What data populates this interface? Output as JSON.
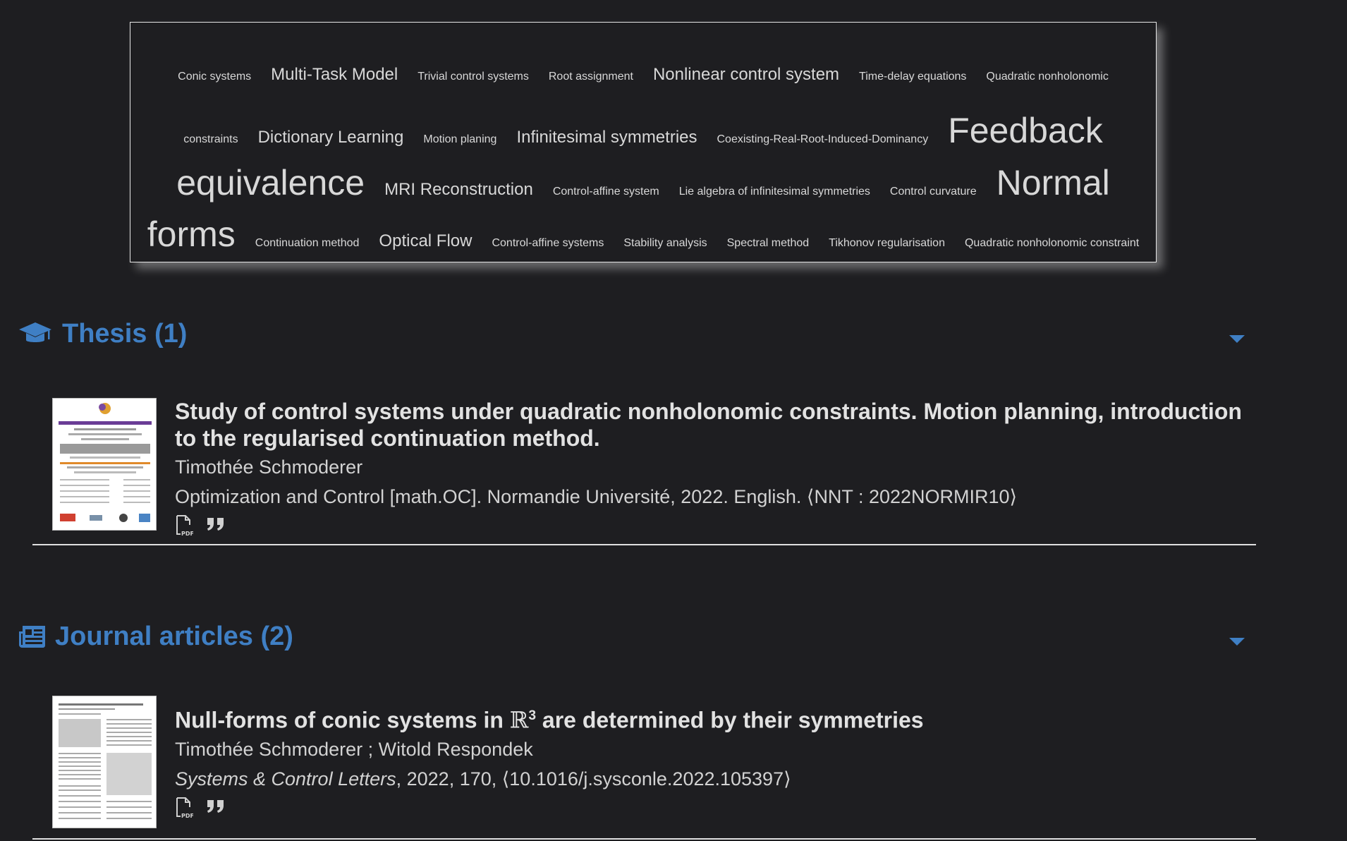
{
  "word_cloud": {
    "line1": [
      "Conic systems",
      "Multi-Task Model",
      "Trivial control systems",
      "Root assignment",
      "Nonlinear control system",
      "Time-delay equations",
      "Quadratic nonholonomic"
    ],
    "line2": [
      "constraints",
      "Dictionary Learning",
      "Motion planing",
      "Infinitesimal symmetries",
      "Coexisting-Real-Root-Induced-Dominancy",
      "Feedback"
    ],
    "line3": [
      "equivalence",
      "MRI Reconstruction",
      "Control-affine system",
      "Lie algebra of infinitesimal symmetries",
      "Control curvature",
      "Normal"
    ],
    "line4": [
      "forms",
      "Continuation method",
      "Optical Flow",
      "Control-affine systems",
      "Stability analysis",
      "Spectral method",
      "Tikhonov regularisation",
      "Quadratic nonholonomic constraint"
    ]
  },
  "thesis": {
    "title": "Thesis (1)",
    "icon": "graduation-cap-icon",
    "items": [
      {
        "title": "Study of control systems under quadratic nonholonomic constraints. Motion planning, introduction to the regularised continuation method.",
        "authors": "Timothée Schmoderer",
        "ref": "Optimization and Control [math.OC]. Normandie Université, 2022. English. ⟨NNT : 2022NORMIR10⟩"
      }
    ]
  },
  "journal": {
    "title": "Journal articles (2)",
    "icon": "newspaper-icon",
    "items": [
      {
        "title_pre": "Null-forms of conic systems in ",
        "title_math": "ℝ",
        "title_sup": "3",
        "title_post": " are determined by their symmetries",
        "authors": "Timothée Schmoderer ; Witold Respondek",
        "journal": "Systems & Control Letters",
        "ref_rest": ", 2022, 170, ⟨10.1016/j.sysconle.2022.105397⟩"
      }
    ]
  },
  "colors": {
    "accent": "#3f7fc4",
    "background": "#1e1e21",
    "text": "#d0d0d0"
  }
}
